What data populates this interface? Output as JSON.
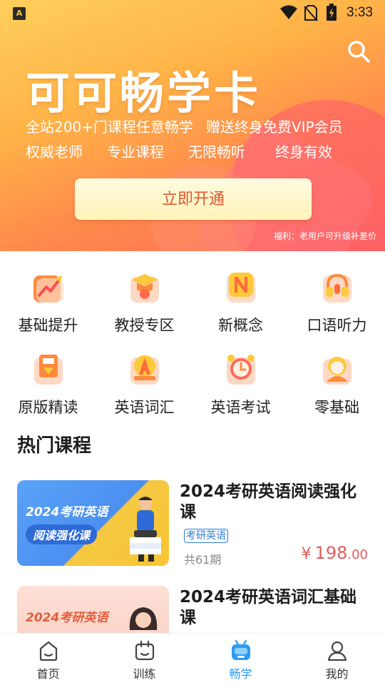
{
  "status_bar": {
    "time": "3:33",
    "app_icon_letter": "A"
  },
  "banner": {
    "title": "可可畅学卡",
    "line1": [
      "全站200+门课程任意畅学",
      "赠送终身免费VIP会员"
    ],
    "features": [
      "权威老师",
      "专业课程",
      "无限畅听",
      "终身有效"
    ],
    "button_label": "立即开通",
    "note": "福利：老用户可升级补差价"
  },
  "categories": [
    {
      "label": "基础提升",
      "icon": "chart-up-icon"
    },
    {
      "label": "教授专区",
      "icon": "graduation-cap-icon"
    },
    {
      "label": "新概念",
      "icon": "letter-n-icon"
    },
    {
      "label": "口语听力",
      "icon": "headphones-icon"
    },
    {
      "label": "原版精读",
      "icon": "bookmark-icon"
    },
    {
      "label": "英语词汇",
      "icon": "letter-a-icon"
    },
    {
      "label": "英语考试",
      "icon": "alarm-clock-icon"
    },
    {
      "label": "零基础",
      "icon": "child-icon"
    }
  ],
  "section_title": "热门课程",
  "courses": [
    {
      "title": "2024考研英语阅读强化课",
      "tag": "考研英语",
      "count": "共61期",
      "price_currency": "¥",
      "price_int": "198",
      "price_dec": ".00",
      "thumb_line1": "2024考研英语",
      "thumb_line2": "阅读强化课"
    },
    {
      "title": "2024考研英语词汇基础课",
      "thumb_line1": "2024考研英语"
    }
  ],
  "bottom_nav": [
    {
      "label": "首页",
      "icon": "home-icon",
      "active": false
    },
    {
      "label": "训练",
      "icon": "calendar-icon",
      "active": false
    },
    {
      "label": "畅学",
      "icon": "robot-icon",
      "active": true
    },
    {
      "label": "我的",
      "icon": "user-icon",
      "active": false
    }
  ],
  "colors": {
    "accent": "#2d9bf0",
    "price": "#e45a5a",
    "button_text": "#e2562e",
    "icon_orange": "#ff8a3d",
    "icon_red": "#ff6b6b"
  }
}
